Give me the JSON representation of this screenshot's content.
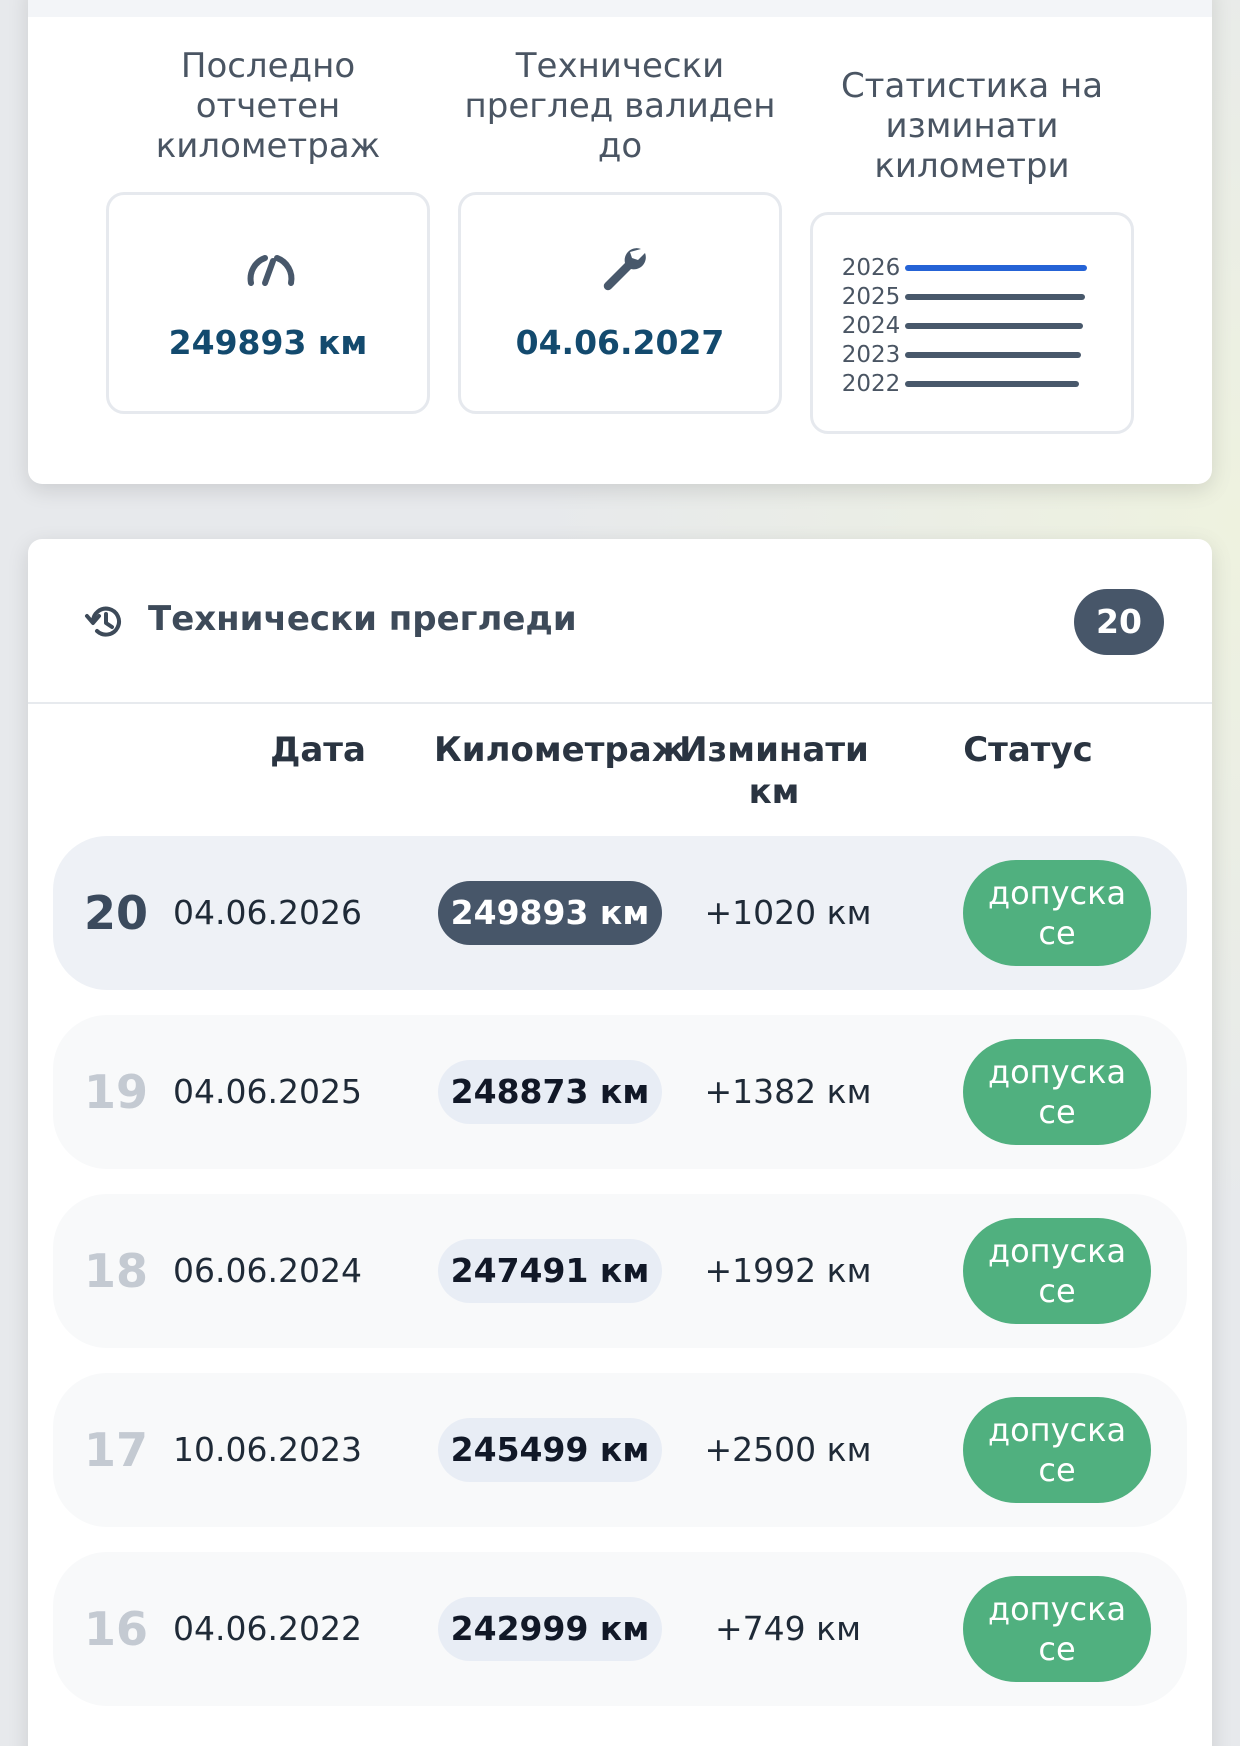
{
  "summary": {
    "mileage": {
      "label": "Последно отчетен километраж",
      "value": "249893 км",
      "icon": "speedometer-icon"
    },
    "inspection": {
      "label": "Технически преглед валиден до",
      "value": "04.06.2027",
      "icon": "wrench-icon"
    },
    "stats": {
      "label": "Статистика на изминати километри",
      "years": [
        "2026",
        "2025",
        "2024",
        "2023",
        "2022"
      ],
      "highlight_color": "#2563d6",
      "bar_color": "#48586b"
    }
  },
  "inspections": {
    "title": "Технически прегледи",
    "count": "20",
    "icon": "history-icon",
    "columns": {
      "date": "Дата",
      "mileage": "Километраж",
      "diff": "Изминати км",
      "status": "Статус"
    },
    "rows": [
      {
        "num": "20",
        "date": "04.06.2026",
        "mileage": "249893 км",
        "diff": "+1020 км",
        "status": "допуска се",
        "active": true
      },
      {
        "num": "19",
        "date": "04.06.2025",
        "mileage": "248873 км",
        "diff": "+1382 км",
        "status": "допуска се",
        "active": false
      },
      {
        "num": "18",
        "date": "06.06.2024",
        "mileage": "247491 км",
        "diff": "+1992 км",
        "status": "допуска се",
        "active": false
      },
      {
        "num": "17",
        "date": "10.06.2023",
        "mileage": "245499 км",
        "diff": "+2500 км",
        "status": "допуска се",
        "active": false
      },
      {
        "num": "16",
        "date": "04.06.2022",
        "mileage": "242999 км",
        "diff": "+749 км",
        "status": "допуска се",
        "active": false
      }
    ],
    "status_color": "#50b07f"
  }
}
